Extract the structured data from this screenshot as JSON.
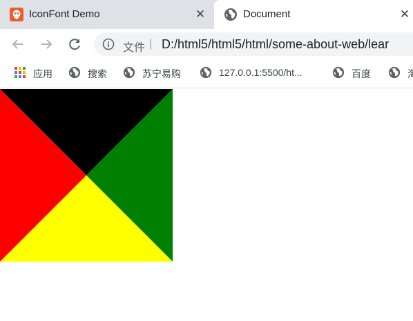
{
  "tabs": [
    {
      "title": "IconFont Demo",
      "favicon": "iconfont-logo-icon",
      "active": false
    },
    {
      "title": "Document",
      "favicon": "globe-icon",
      "active": true
    }
  ],
  "toolbar": {
    "back_icon": "arrow-left-icon",
    "forward_icon": "arrow-right-icon",
    "reload_icon": "reload-icon",
    "info_icon": "info-icon",
    "secure_label": "文件",
    "separator": "|",
    "url": "D:/html5/html5/html/some-about-web/lear"
  },
  "bookmarks": [
    {
      "label": "应用",
      "icon": "apps-grid-icon"
    },
    {
      "label": "搜索",
      "icon": "globe-icon"
    },
    {
      "label": "苏宁易购",
      "icon": "globe-icon"
    },
    {
      "label": "127.0.0.1:5500/ht...",
      "icon": "globe-icon"
    },
    {
      "label": "百度",
      "icon": "globe-icon"
    },
    {
      "label": "淘",
      "icon": "globe-icon"
    }
  ],
  "close_glyph": "✕",
  "page": {
    "triangle_colors": {
      "top": "#000000",
      "right": "#008000",
      "bottom": "#ffff00",
      "left": "#ff0000"
    }
  }
}
